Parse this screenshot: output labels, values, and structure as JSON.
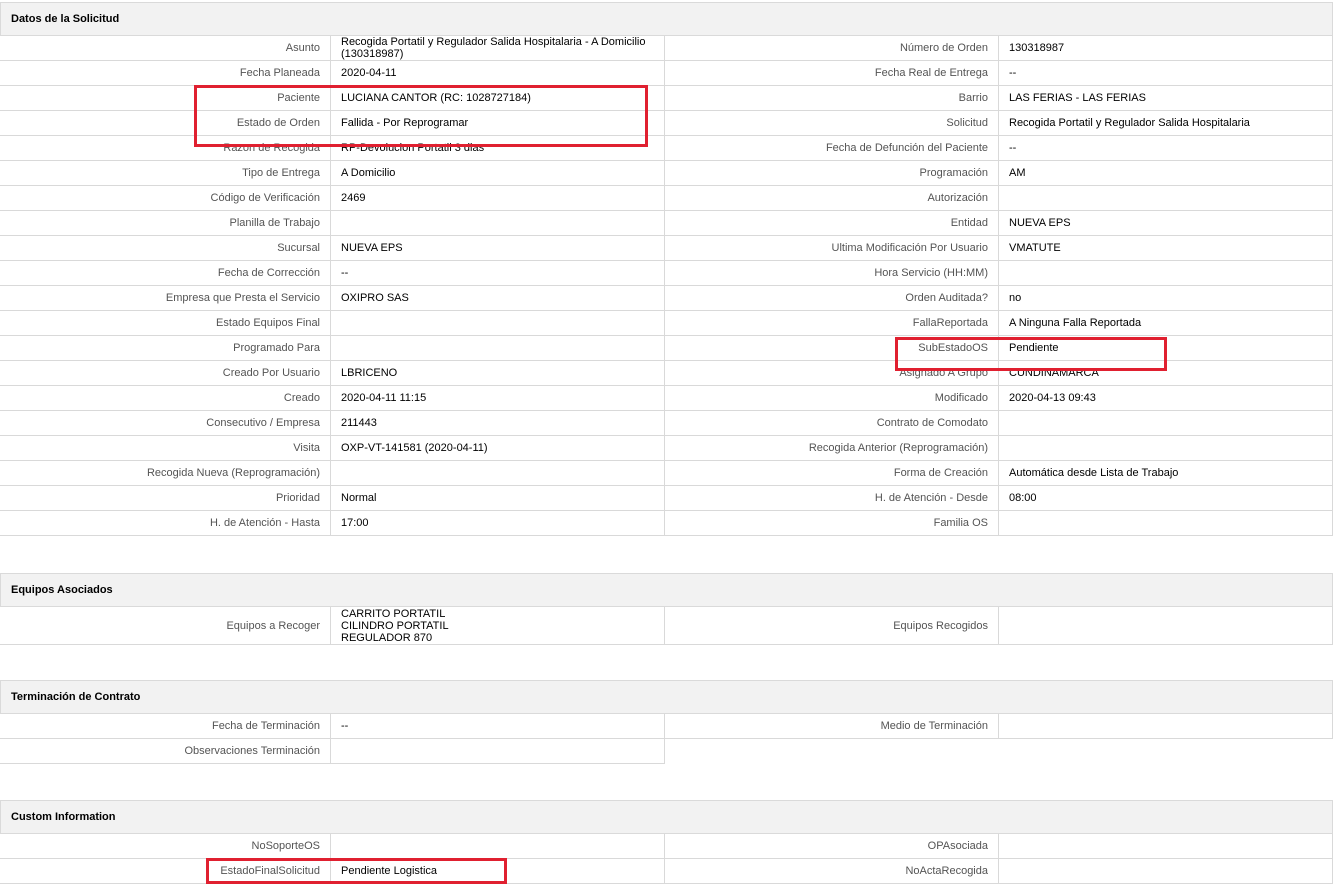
{
  "section1": {
    "title": "Datos de la Solicitud",
    "rows": [
      {
        "l1": "Asunto",
        "v1": "Recogida Portatil y Regulador Salida Hospitalaria - A Domicilio (130318987)",
        "l2": "Número de Orden",
        "v2": "130318987"
      },
      {
        "l1": "Fecha Planeada",
        "v1": " 2020-04-11",
        "l2": "Fecha Real de Entrega",
        "v2": " --"
      },
      {
        "l1": "Paciente",
        "v1": "LUCIANA CANTOR (RC: 1028727184)",
        "l2": "Barrio",
        "v2": "LAS FERIAS - LAS FERIAS"
      },
      {
        "l1": "Estado de Orden",
        "v1": "Fallida - Por Reprogramar",
        "l2": "Solicitud",
        "v2": "Recogida Portatil y Regulador Salida Hospitalaria"
      },
      {
        "l1": "Razon de Recogida",
        "v1": "RP-Devolucion Portatil 3 dias",
        "l2": "Fecha de Defunción del Paciente",
        "v2": " --"
      },
      {
        "l1": "Tipo de Entrega",
        "v1": "A Domicilio",
        "l2": "Programación",
        "v2": "AM"
      },
      {
        "l1": "Código de Verificación",
        "v1": "2469",
        "l2": "Autorización",
        "v2": ""
      },
      {
        "l1": "Planilla de Trabajo",
        "v1": "",
        "l2": "Entidad",
        "v2": "NUEVA EPS"
      },
      {
        "l1": "Sucursal",
        "v1": "NUEVA EPS",
        "l2": "Ultima Modificación Por Usuario",
        "v2": "VMATUTE"
      },
      {
        "l1": "Fecha de Corrección",
        "v1": " --",
        "l2": "Hora Servicio (HH:MM)",
        "v2": ""
      },
      {
        "l1": "Empresa que Presta el Servicio",
        "v1": "OXIPRO SAS",
        "l2": "Orden Auditada?",
        "v2": " no"
      },
      {
        "l1": "Estado Equipos Final",
        "v1": "",
        "l2": "FallaReportada",
        "v2": "A Ninguna Falla Reportada"
      },
      {
        "l1": "Programado Para",
        "v1": "",
        "l2": "SubEstadoOS",
        "v2": "Pendiente"
      },
      {
        "l1": "Creado Por Usuario",
        "v1": "LBRICENO",
        "l2": "Asignado A Grupo",
        "v2": "CUNDINAMARCA"
      },
      {
        "l1": "Creado",
        "v1": "2020-04-11 11:15",
        "l2": "Modificado",
        "v2": "2020-04-13 09:43"
      },
      {
        "l1": "Consecutivo / Empresa",
        "v1": "211443",
        "l2": "Contrato de Comodato",
        "v2": ""
      },
      {
        "l1": "Visita",
        "v1": "OXP-VT-141581 (2020-04-11)",
        "l2": "Recogida Anterior (Reprogramación)",
        "v2": ""
      },
      {
        "l1": "Recogida Nueva (Reprogramación)",
        "v1": "",
        "l2": "Forma de Creación",
        "v2": "Automática desde Lista de Trabajo"
      },
      {
        "l1": "Prioridad",
        "v1": "Normal",
        "l2": "H. de Atención - Desde",
        "v2": "08:00"
      },
      {
        "l1": "H. de Atención - Hasta",
        "v1": "17:00",
        "l2": "Familia OS",
        "v2": ""
      }
    ]
  },
  "section2": {
    "title": "Equipos Asociados",
    "l1": "Equipos a Recoger",
    "v1": "CARRITO PORTATIL\nCILINDRO PORTATIL\nREGULADOR 870",
    "l2": "Equipos Recogidos",
    "v2": ""
  },
  "section3": {
    "title": "Terminación de Contrato",
    "rows": [
      {
        "l1": "Fecha de Terminación",
        "v1": " --",
        "l2": "Medio de Terminación",
        "v2": ""
      },
      {
        "l1": "Observaciones Terminación",
        "v1": ""
      }
    ]
  },
  "section4": {
    "title": "Custom Information",
    "rows": [
      {
        "l1": "NoSoporteOS",
        "v1": "",
        "l2": "OPAsociada",
        "v2": ""
      },
      {
        "l1": "EstadoFinalSolicitud",
        "v1": "Pendiente Logistica",
        "l2": "NoActaRecogida",
        "v2": ""
      }
    ]
  },
  "highlight_color": "#e02030"
}
